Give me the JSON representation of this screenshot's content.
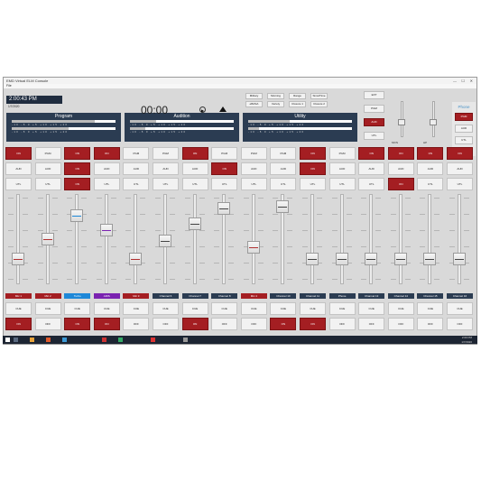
{
  "window": {
    "title": "EMD Virtual ELM Console",
    "menu": "File"
  },
  "clock": {
    "time": "2:00:43 PM",
    "date": "1/7/2020"
  },
  "panels": [
    {
      "title": "Program",
      "levels": [
        0.8,
        0.55
      ]
    },
    {
      "title": "Audition",
      "levels": [
        0.25,
        0.15
      ]
    },
    {
      "title": "Utility",
      "levels": [
        0.4,
        0.1
      ]
    }
  ],
  "meter_scale": [
    "-10",
    "-5",
    "0",
    "+5",
    "+10",
    "+15",
    "+20"
  ],
  "timer": "00:00",
  "top_buttons": [
    "Military",
    "Morning",
    "Range",
    "SimulTime",
    "eBASA",
    "Veriety",
    "Closure 1",
    "Closure 2"
  ],
  "side_buttons": [
    {
      "label": "EXT",
      "on": false
    },
    {
      "label": "PGM",
      "on": false
    },
    {
      "label": "AUD",
      "on": true
    },
    {
      "label": "UTL",
      "on": false
    }
  ],
  "mini_faders": [
    {
      "label": "MON",
      "level": 0.4
    },
    {
      "label": "HP",
      "level": 0.4
    }
  ],
  "phones": {
    "title": "Phone",
    "buttons": [
      {
        "label": "PGM",
        "on": true
      },
      {
        "label": "AUD",
        "on": false
      },
      {
        "label": "UTL",
        "on": false
      }
    ]
  },
  "channels": [
    {
      "label": "Mic 1",
      "label_color": "#a41e22",
      "pgm": true,
      "aud": false,
      "utl": false,
      "level": 0.25,
      "stripe": "#b03030",
      "cue": false,
      "off": true
    },
    {
      "label": "Mic 2",
      "label_color": "#a41e22",
      "pgm": false,
      "aud": false,
      "utl": false,
      "level": 0.5,
      "stripe": "#b03030",
      "cue": false,
      "off": false
    },
    {
      "label": "Turbo",
      "label_color": "#1e88d8",
      "pgm": true,
      "aud": true,
      "utl": true,
      "level": 0.8,
      "stripe": "#1e88d8",
      "cue": false,
      "off": true
    },
    {
      "label": "ARIS",
      "label_color": "#7a22b0",
      "pgm": true,
      "aud": false,
      "utl": false,
      "level": 0.62,
      "stripe": "#7a22b0",
      "cue": false,
      "off": true
    },
    {
      "label": "Mic 3",
      "label_color": "#a41e22",
      "pgm": false,
      "aud": false,
      "utl": false,
      "level": 0.25,
      "stripe": "#b03030",
      "cue": false,
      "off": false
    },
    {
      "label": "Channel 6",
      "label_color": "#2b3c52",
      "pgm": false,
      "aud": false,
      "utl": false,
      "level": 0.48,
      "stripe": "#444444",
      "cue": false,
      "off": false
    },
    {
      "label": "Channel 7",
      "label_color": "#2b3c52",
      "pgm": true,
      "aud": false,
      "utl": false,
      "level": 0.7,
      "stripe": "#444444",
      "cue": false,
      "off": true
    },
    {
      "label": "Channel 8",
      "label_color": "#2b3c52",
      "pgm": false,
      "aud": true,
      "utl": false,
      "level": 0.9,
      "stripe": "#444444",
      "cue": false,
      "off": false
    },
    {
      "label": "Mic 4",
      "label_color": "#a41e22",
      "pgm": false,
      "aud": false,
      "utl": false,
      "level": 0.4,
      "stripe": "#b03030",
      "cue": false,
      "off": false
    },
    {
      "label": "Channel 10",
      "label_color": "#2b3c52",
      "pgm": false,
      "aud": false,
      "utl": false,
      "level": 0.92,
      "stripe": "#444444",
      "cue": false,
      "off": true
    },
    {
      "label": "Channel 11",
      "label_color": "#2b3c52",
      "pgm": true,
      "aud": true,
      "utl": false,
      "level": 0.25,
      "stripe": "#444444",
      "cue": false,
      "off": true
    },
    {
      "label": "Phone",
      "label_color": "#2b3c52",
      "pgm": false,
      "aud": false,
      "utl": false,
      "level": 0.25,
      "stripe": "#444444",
      "cue": false,
      "off": false
    },
    {
      "label": "Channel 13",
      "label_color": "#2b3c52",
      "pgm": true,
      "aud": false,
      "utl": false,
      "level": 0.25,
      "stripe": "#444444",
      "cue": false,
      "off": false
    },
    {
      "label": "Channel 14",
      "label_color": "#2b3c52",
      "pgm": true,
      "aud": false,
      "utl": true,
      "level": 0.25,
      "stripe": "#444444",
      "cue": false,
      "off": false
    },
    {
      "label": "Channel 15",
      "label_color": "#2b3c52",
      "pgm": true,
      "aud": false,
      "utl": false,
      "level": 0.25,
      "stripe": "#444444",
      "cue": false,
      "off": false
    },
    {
      "label": "Channel 16",
      "label_color": "#2b3c52",
      "pgm": true,
      "aud": false,
      "utl": false,
      "level": 0.25,
      "stripe": "#444444",
      "cue": false,
      "off": false
    }
  ],
  "channel_button_labels": {
    "pgm": "PGM",
    "aud": "AUD",
    "utl": "UTL",
    "cue": "CUE",
    "on": "ON",
    "off": "OFF"
  },
  "taskbar": {
    "time": "2:00 PM",
    "date": "1/7/2020"
  },
  "colors": {
    "on_red": "#a41e22",
    "panel_navy": "#2b3c52"
  }
}
